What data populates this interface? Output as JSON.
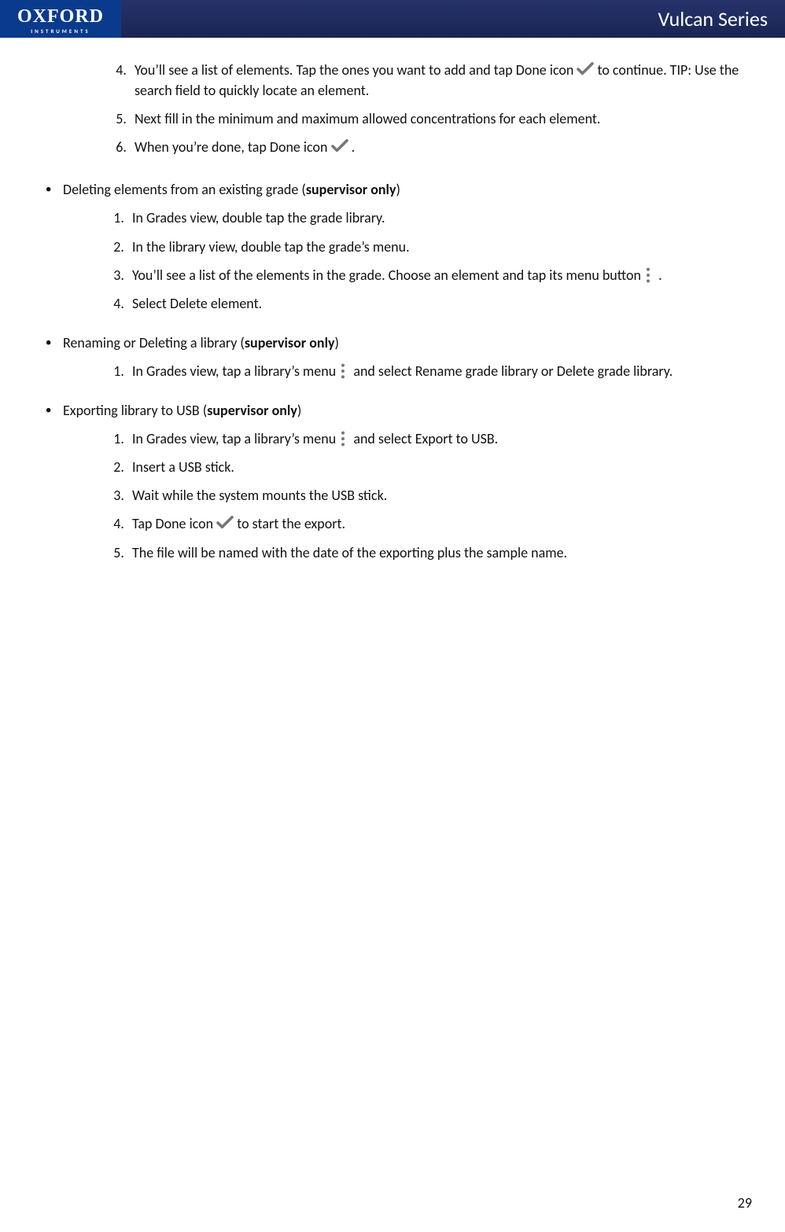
{
  "header": {
    "logo_main": "OXFORD",
    "logo_sub": "INSTRUMENTS",
    "title": "Vulcan Series"
  },
  "intro": {
    "start": 4,
    "items": [
      {
        "pre": "You’ll see a list of elements. Tap the ones you want to add and tap Done icon ",
        "icon": "check",
        "post": " to continue. TIP: Use the search field to quickly locate an element."
      },
      {
        "pre": "Next fill in the minimum and maximum allowed concentrations for each element.",
        "icon": null,
        "post": ""
      },
      {
        "pre": "When you’re done, tap Done icon ",
        "icon": "check",
        "post": " ."
      }
    ]
  },
  "sections": [
    {
      "title": "Deleting elements from an existing grade (",
      "role": "supervisor only",
      "title_end": ")",
      "steps": [
        {
          "pre": "In Grades view, double tap the grade library."
        },
        {
          "pre": "In the library view, double tap the grade’s menu."
        },
        {
          "pre": "You’ll see a list of the elements in the grade. Choose an element and tap its menu button ",
          "icon": "menu",
          "post": " ."
        },
        {
          "pre": "Select Delete element."
        }
      ]
    },
    {
      "title": "Renaming or Deleting a library (",
      "role": "supervisor only",
      "title_end": ")",
      "steps": [
        {
          "pre": "In Grades view, tap a library’s menu ",
          "icon": "menu",
          "post": " and select Rename grade library or Delete grade library."
        }
      ]
    },
    {
      "title": "Exporting library to USB (",
      "role": "supervisor only",
      "title_end": ")",
      "steps": [
        {
          "pre": "In Grades view, tap a library’s menu ",
          "icon": "menu",
          "post": " and select Export to USB."
        },
        {
          "pre": "Insert a USB stick."
        },
        {
          "pre": "Wait while the system mounts the USB stick."
        },
        {
          "pre": "Tap Done icon ",
          "icon": "check",
          "post": " to start the export."
        },
        {
          "pre": "The file will be named with the date of the exporting plus the sample name."
        }
      ]
    }
  ],
  "page_number": "29"
}
